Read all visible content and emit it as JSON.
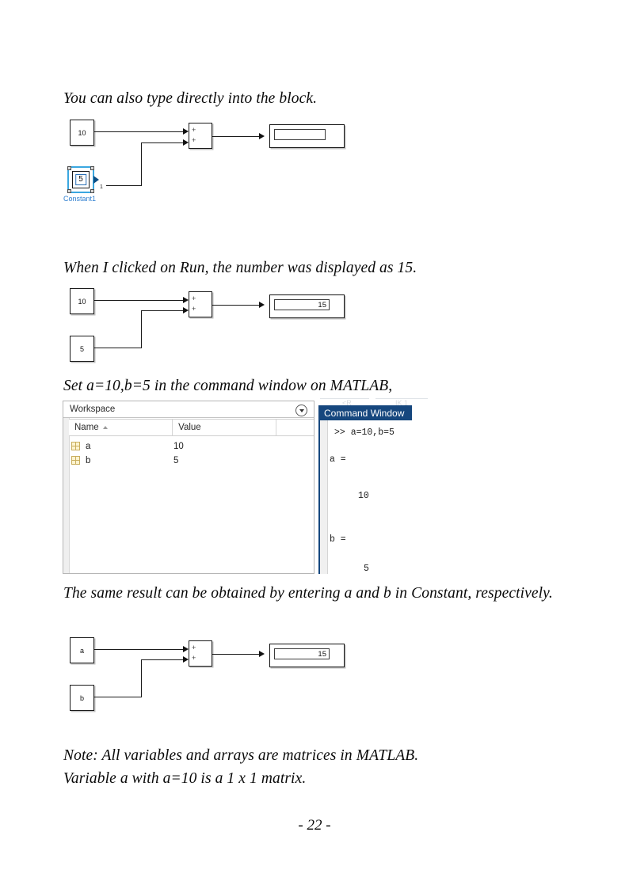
{
  "document": {
    "page_number": "- 22 -",
    "paragraphs": {
      "p1": "You can also type directly into the block.",
      "p2": "When I clicked on Run, the number was displayed as 15.",
      "p3": "Set a=10,b=5 in the command window on MATLAB,",
      "p4": "The same result can be obtained by entering a and b in Constant, respectively.",
      "p5_line1": "Note: All variables and arrays are matrices in MATLAB.",
      "p5_line2": "Variable a with a=10 is a 1 x 1 matrix."
    }
  },
  "diagram1": {
    "const_top_value": "10",
    "selected_block": {
      "edit_value": "5",
      "port_number": "1",
      "caption": "Constant1",
      "caption_color": "#2f7fd0",
      "selection_color": "#3aa7e0"
    },
    "sum_block": {
      "sign_top": "+",
      "sign_bottom": "+"
    },
    "display_value": ""
  },
  "diagram2": {
    "const_top_value": "10",
    "const_bottom_value": "5",
    "sum_block": {
      "sign_top": "+",
      "sign_bottom": "+"
    },
    "display_value": "15"
  },
  "diagram3": {
    "const_top_value": "a",
    "const_bottom_value": "b",
    "sum_block": {
      "sign_top": "+",
      "sign_bottom": "+"
    },
    "display_value": "15"
  },
  "workspace": {
    "title": "Workspace",
    "dropdown_icon": "chevron-down-circle-icon",
    "columns": [
      "Name",
      "Value"
    ],
    "sort_indicator": "ascending",
    "rows": [
      {
        "icon": "matrix-variable-icon",
        "name": "a",
        "value": "10"
      },
      {
        "icon": "matrix-variable-icon",
        "name": "b",
        "value": "5"
      }
    ]
  },
  "command_window": {
    "title": "Command Window",
    "title_bg": "#16477e",
    "lines": [
      ">> a=10,b=5",
      "",
      "a =",
      "",
      "    10",
      "",
      "",
      "b =",
      "",
      "     5"
    ],
    "line_prompt": ">> a=10,b=5",
    "line_a_label": "a =",
    "line_a_value": "10",
    "line_b_label": "b =",
    "line_b_value": "5"
  }
}
